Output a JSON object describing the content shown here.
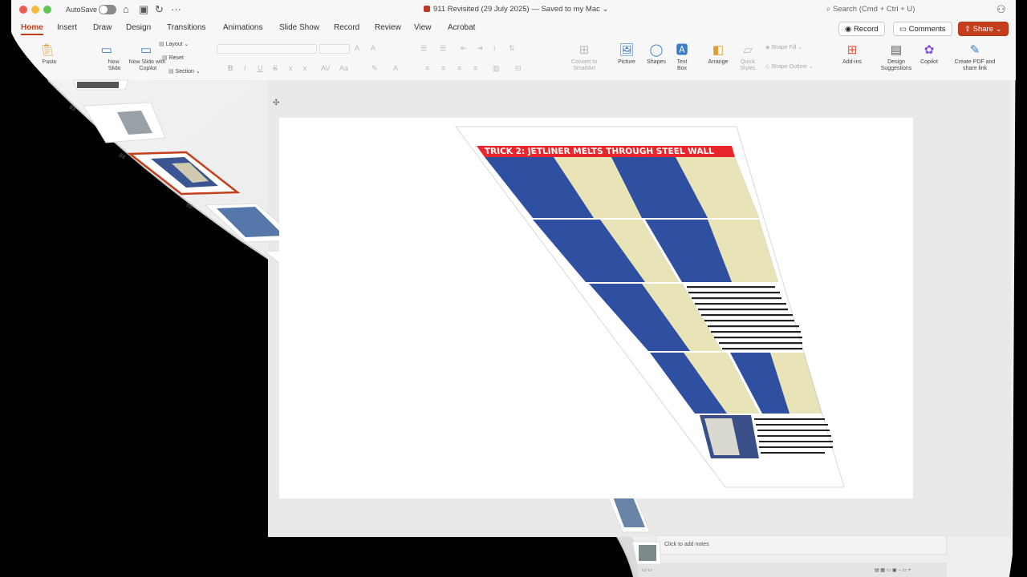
{
  "window": {
    "autosave_label": "AutoSave",
    "doc_title": "911 Revisited (29 July 2025) — Saved to my Mac ⌄",
    "search_placeholder": "Search (Cmd + Ctrl + U)"
  },
  "menu": {
    "tabs": [
      "Home",
      "Insert",
      "Draw",
      "Design",
      "Transitions",
      "Animations",
      "Slide Show",
      "Record",
      "Review",
      "View",
      "Acrobat"
    ],
    "active_tab": "Home",
    "record_label": "Record",
    "comments_label": "Comments",
    "share_label": "Share"
  },
  "ribbon": {
    "paste": "Paste",
    "new_slide": "New Slide",
    "new_slide_copilot": "New Slide with Copilot",
    "layout": "Layout",
    "reset": "Reset",
    "section": "Section",
    "convert_smartart": "Convert to SmartArt",
    "picture": "Picture",
    "shapes": "Shapes",
    "text_box": "Text Box",
    "arrange": "Arrange",
    "quick_styles": "Quick Styles",
    "shape_fill": "Shape Fill",
    "shape_outline": "Shape Outline",
    "add_ins": "Add-ins",
    "design_suggestions": "Design Suggestions",
    "copilot": "Copilot",
    "create_pdf": "Create PDF and share link"
  },
  "slide": {
    "title": "TRICK 2: JETLINER MELTS THROUGH STEEL WALL"
  },
  "thumbnails": {
    "numbers": [
      "83",
      "84",
      "85"
    ]
  },
  "notes": {
    "placeholder": "Click to add notes"
  },
  "colors": {
    "accent": "#c43e1c",
    "slide_title_bar": "#e8262b",
    "photo_sky": "#2f4fa0",
    "photo_wall": "#e8e4b8"
  }
}
